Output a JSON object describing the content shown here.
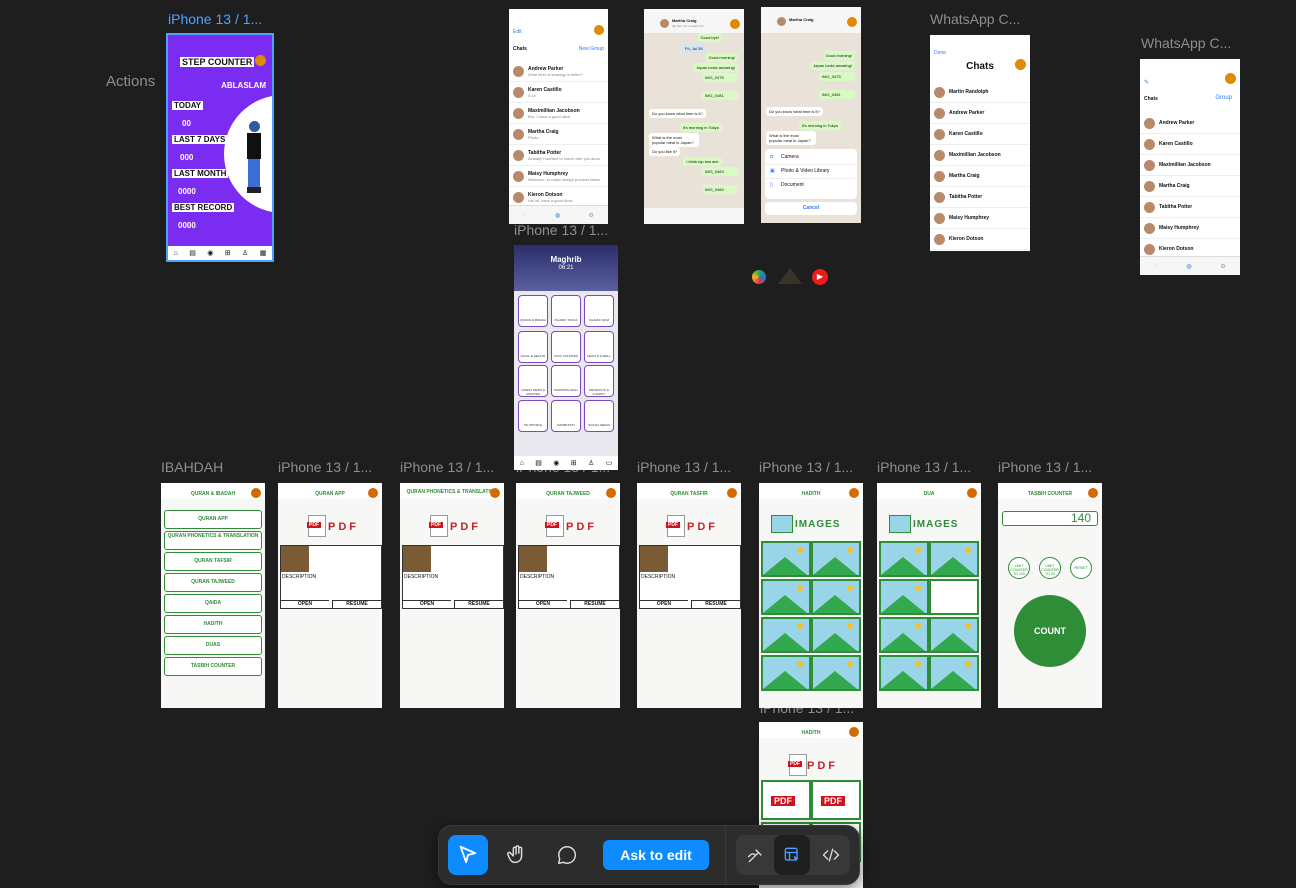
{
  "canvas": {
    "actions_label": "Actions",
    "frame_labels": {
      "step_counter": "iPhone 13 / 1...",
      "islam_app": "iPhone 13 / 1...",
      "whatsapp_1": "WhatsApp C...",
      "whatsapp_2": "WhatsApp C...",
      "ibahdah": "IBAHDAH",
      "quran_app": "iPhone 13 / 1...",
      "phonetics": "iPhone 13 / 1...",
      "tajweed": "iPhone 13 / 1...",
      "tafsir": "iPhone 13 / 1...",
      "hadith": "iPhone 13 / 1...",
      "dua": "iPhone 13 / 1...",
      "tasbih": "iPhone 13 / 1...",
      "hadith_pdf": "iPhone 13 / 1..."
    }
  },
  "step_counter": {
    "title": "STEP COUNTER",
    "name": "ABLASLAM",
    "today": "TODAY",
    "today_val": "00",
    "last7": "LAST 7 DAYS",
    "last7_val": "000",
    "month": "LAST MONTH",
    "month_val": "0000",
    "best": "BEST RECORD",
    "best_val": "0000"
  },
  "chats_small": {
    "edit": "Edit",
    "title": "Chats",
    "new_group": "New Group",
    "rows": [
      {
        "name": "Andrew Parker",
        "msg": "What kind of strategy is better?"
      },
      {
        "name": "Karen Castillo",
        "msg": "0:14"
      },
      {
        "name": "Maximillian Jacobson",
        "msg": "Bro, I have a good idea!"
      },
      {
        "name": "Martha Craig",
        "msg": "Photo"
      },
      {
        "name": "Tabitha Potter",
        "msg": "Actually I wanted to check with you about your online business plan on our..."
      },
      {
        "name": "Maisy Humphrey",
        "msg": "Welcome, to make design process faster, look at Pixsellz"
      },
      {
        "name": "Kieron Dotson",
        "msg": "Ha-ha, have a good time!"
      }
    ]
  },
  "conversation": {
    "contact": "Martha Craig",
    "status": "tap here for contact info",
    "messages": [
      "Good bye!",
      "Fri, Jul 26",
      "Good morning!",
      "Japan looks amazing!",
      "IMG_0475",
      "IMG_0481",
      "Do you know what time is it?",
      "It's morning in Tokyo",
      "What is the most popular meal in Japan?",
      "Do you like it?",
      "I think top two are:",
      "IMG_0483",
      "IMG_0484"
    ]
  },
  "attach_sheet": {
    "camera": "Camera",
    "library": "Photo & Video Library",
    "document": "Document",
    "cancel": "Cancel"
  },
  "chats_medium": {
    "done": "Done",
    "title": "Chats",
    "rows": [
      "Martin Randolph",
      "Andrew Parker",
      "Karen Castillo",
      "Maximillian Jacobson",
      "Martha Craig",
      "Tabitha Potter",
      "Maisy Humphrey",
      "Kieron Dotson"
    ]
  },
  "chats_right": {
    "title": "Chats",
    "group": "Group",
    "rows": [
      "Andrew Parker",
      "Karen Castillo",
      "Maximillian Jacobson",
      "Martha Craig",
      "Tabitha Potter",
      "Maisy Humphrey",
      "Kieron Dotson"
    ]
  },
  "islam_app": {
    "prayer": "Maghrib",
    "time": "06:21",
    "cards": [
      "QURAN & IBADAH",
      "ISLAMIC TOOLS",
      "ISLAMIC QUIZ",
      "HALAL & HEALTH",
      "CIVIC COUNTER",
      "HEALTH & WELL",
      "LATEST NEWS & UPDATES",
      "SHOPPING MALL",
      "PRODUCTS & CHARITY",
      "MY PROFILE",
      "COMMUNITY",
      "SOCIAL MEDIA"
    ]
  },
  "ibahdah": {
    "title": "QURAN & IBADAH",
    "items": [
      "QURAN APP",
      "QURAN PHONETICS & TRANSLATION",
      "QURAN TAFSIR",
      "QURAN TAJWEED",
      "QAIDA",
      "HADITH",
      "DUAS",
      "TASBIH COUNTER"
    ]
  },
  "pdf_frames": {
    "pdf_word": "PDF",
    "description": "DESCRIPTION",
    "open": "OPEN",
    "resume": "RESUME",
    "titles": [
      "QURAN APP",
      "QURAN PHONETICS & TRANSLATION",
      "QURAN TAJWEED",
      "QURAN TASFIR"
    ]
  },
  "image_frames": {
    "images_word": "IMAGES",
    "hadith_title": "HADITH",
    "dua_title": "DUA"
  },
  "tasbih": {
    "title": "TASBIH COUNTER",
    "count": "140",
    "btn1": "LIMIT COUNTER TO 100",
    "btn2": "LIMIT COUNTER TO 33",
    "btn3": "RESET",
    "count_label": "COUNT"
  },
  "hadith_pdf": {
    "title": "HADITH",
    "pdf_word": "PDF",
    "tile_label": "PDF"
  },
  "toolbar": {
    "ask_label": "Ask to edit"
  }
}
